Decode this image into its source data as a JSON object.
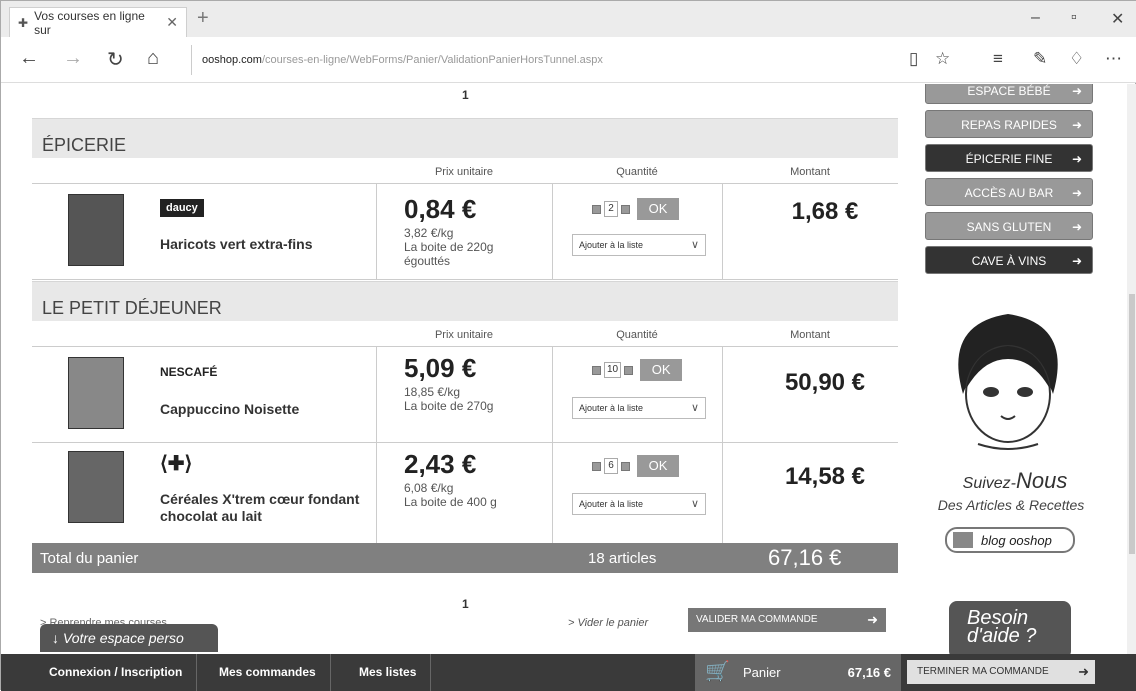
{
  "browser": {
    "tab_title": "Vos courses en ligne sur",
    "url_domain": "ooshop.com",
    "url_path": "/courses-en-ligne/WebForms/Panier/ValidationPanierHorsTunnel.aspx"
  },
  "pagination": {
    "top": "1",
    "bottom": "1"
  },
  "columns": {
    "prix": "Prix unitaire",
    "quantite": "Quantité",
    "montant": "Montant"
  },
  "sections": [
    {
      "title": "ÉPICERIE",
      "items": [
        {
          "brand": "daucy",
          "name": "Haricots vert extra-fins",
          "price": "0,84 €",
          "per_kg": "3,82 €/kg",
          "desc": "La boite de 220g égouttés",
          "qty": "2",
          "add_list": "Ajouter à la liste",
          "amount": "1,68 €"
        }
      ]
    },
    {
      "title": "LE PETIT DÉJEUNER",
      "items": [
        {
          "brand": "NESCAFÉ",
          "name": "Cappuccino Noisette",
          "price": "5,09 €",
          "per_kg": "18,85 €/kg",
          "desc": "La boite de 270g",
          "qty": "10",
          "add_list": "Ajouter à la liste",
          "amount": "50,90 €"
        },
        {
          "brand": "Carrefour",
          "name": "Céréales X'trem cœur fondant chocolat au lait",
          "price": "2,43 €",
          "per_kg": "6,08 €/kg",
          "desc": "La boite de 400 g",
          "qty": "6",
          "add_list": "Ajouter à la liste",
          "amount": "14,58 €"
        }
      ]
    }
  ],
  "ok_label": "OK",
  "total": {
    "label": "Total du panier",
    "count": "18 articles",
    "amount": "67,16 €"
  },
  "actions": {
    "reprendre": "> Reprendre mes courses",
    "vider": "> Vider le panier",
    "valider": "VALIDER MA COMMANDE"
  },
  "espace_perso": "Votre espace perso",
  "sidebar": {
    "buttons": [
      {
        "label": "ESPACE BÉBÉ",
        "dark": false
      },
      {
        "label": "REPAS RAPIDES",
        "dark": false
      },
      {
        "label": "ÉPICERIE FINE",
        "dark": true
      },
      {
        "label": "ACCÈS AU BAR",
        "dark": false
      },
      {
        "label": "SANS GLUTEN",
        "dark": false
      },
      {
        "label": "CAVE À VINS",
        "dark": true
      }
    ],
    "suivez": "Suivez-",
    "nous": "Nous",
    "articles": "Des Articles & Recettes",
    "blog": "blog ooshop",
    "besoin_1": "Besoin",
    "besoin_2": "d'aide ?"
  },
  "bottom_bar": {
    "connexion": "Connexion / Inscription",
    "commandes": "Mes commandes",
    "listes": "Mes listes",
    "panier": "Panier",
    "panier_total": "67,16 €",
    "terminer": "TERMINER MA COMMANDE"
  }
}
